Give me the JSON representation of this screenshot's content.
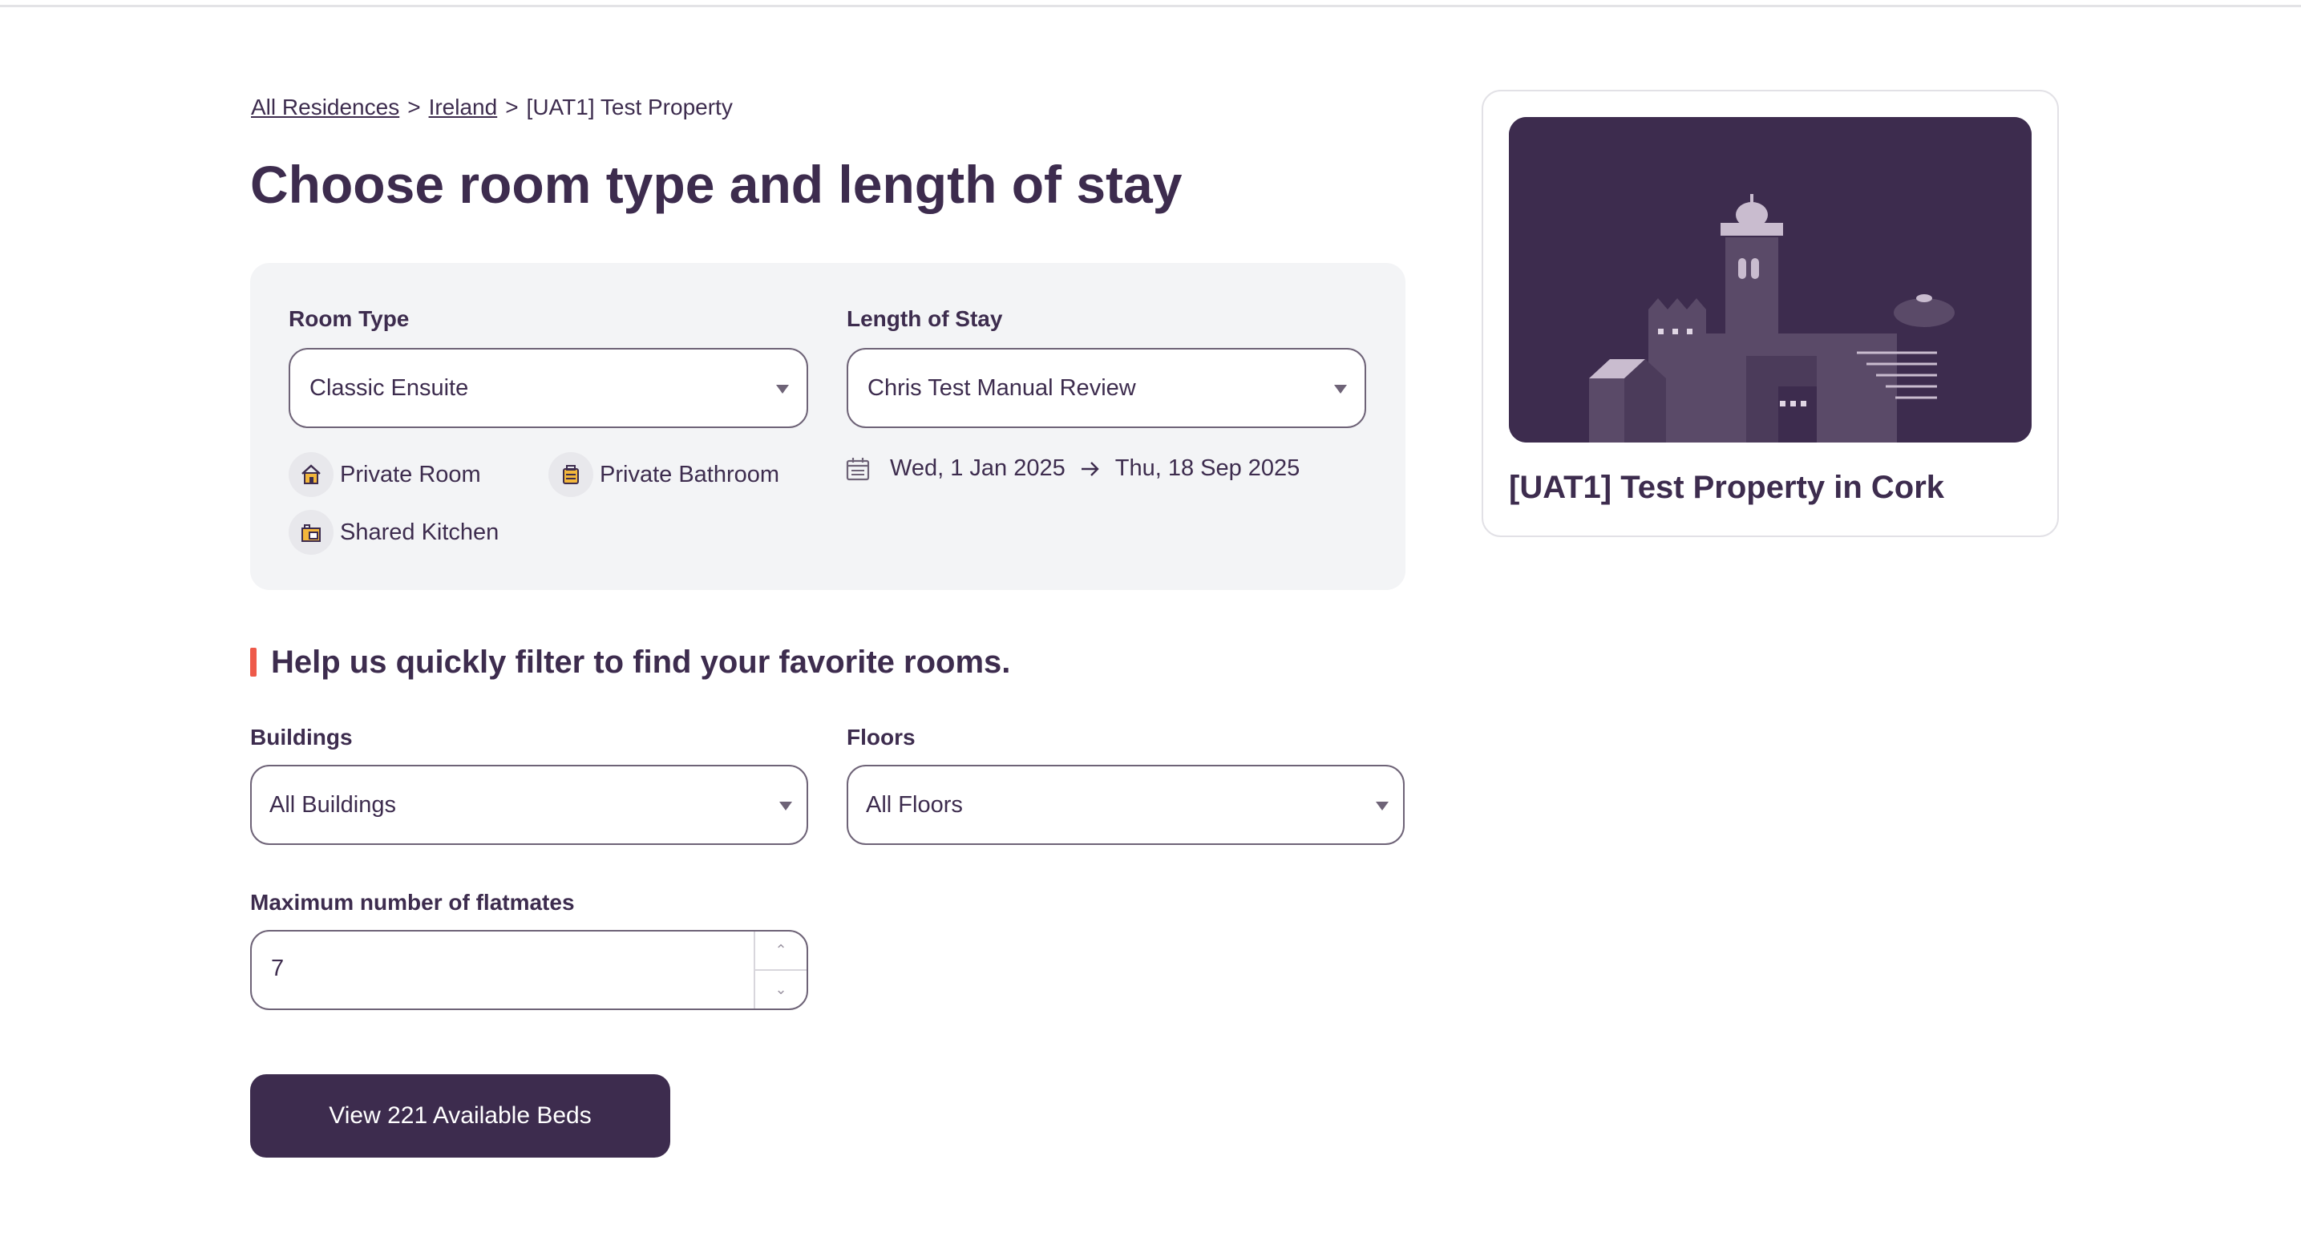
{
  "breadcrumb": {
    "items": [
      {
        "label": "All Residences"
      },
      {
        "label": "Ireland"
      }
    ],
    "separator": ">",
    "current": "[UAT1] Test Property"
  },
  "page_title": "Choose room type and length of stay",
  "room_type": {
    "label": "Room Type",
    "value": "Classic Ensuite",
    "features": [
      {
        "icon": "house-icon",
        "label": "Private Room"
      },
      {
        "icon": "bathroom-icon",
        "label": "Private Bathroom"
      },
      {
        "icon": "kitchen-icon",
        "label": "Shared Kitchen"
      }
    ]
  },
  "length_of_stay": {
    "label": "Length of Stay",
    "value": "Chris Test Manual Review",
    "start_date": "Wed, 1 Jan 2025",
    "end_date": "Thu, 18 Sep 2025"
  },
  "filters": {
    "heading": "Help us quickly filter to find your favorite rooms.",
    "buildings": {
      "label": "Buildings",
      "value": "All Buildings"
    },
    "floors": {
      "label": "Floors",
      "value": "All Floors"
    },
    "flatmates": {
      "label": "Maximum number of flatmates",
      "value": "7"
    }
  },
  "cta": {
    "label": "View 221 Available Beds"
  },
  "property_card": {
    "name": "[UAT1] Test Property in Cork"
  },
  "colors": {
    "primary": "#3d2c4e",
    "accent": "#ee5a4a",
    "panel": "#f3f4f6"
  }
}
